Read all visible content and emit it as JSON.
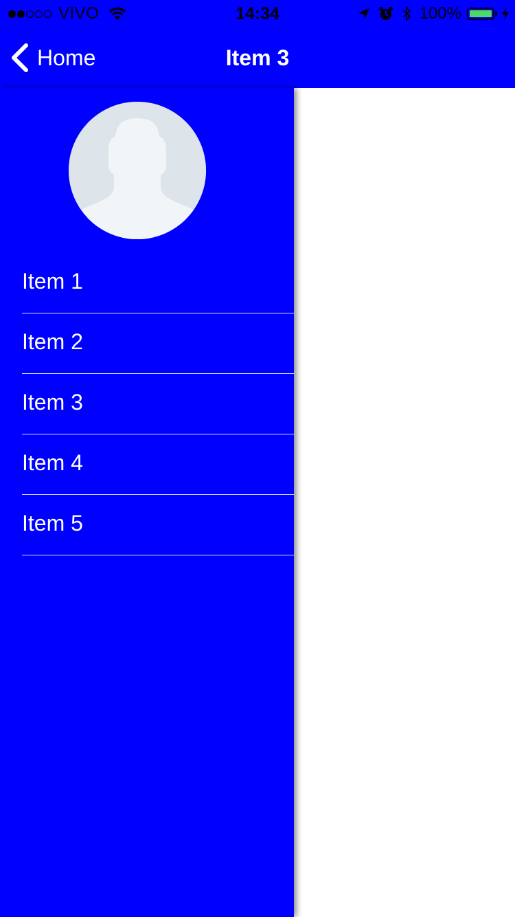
{
  "status_bar": {
    "carrier": "VIVO",
    "time": "14:34",
    "battery": "100%",
    "signal_bars_filled": 2,
    "signal_bars_total": 5,
    "battery_level": 1.0,
    "icons": [
      "wifi-icon",
      "location-arrow-icon",
      "alarm-icon",
      "bluetooth-icon",
      "charging-bolt-icon"
    ]
  },
  "nav": {
    "back_label": "Home",
    "title": "Item 3"
  },
  "drawer": {
    "avatar_icon": "default-user-avatar-icon",
    "items": [
      {
        "label": "Item 1"
      },
      {
        "label": "Item 2"
      },
      {
        "label": "Item 3"
      },
      {
        "label": "Item 4"
      },
      {
        "label": "Item 5"
      }
    ]
  },
  "colors": {
    "accent": "#0000ff",
    "text_on_accent": "#ffffff",
    "battery_fill": "#4cd964",
    "avatar_bg": "#dde4ea",
    "avatar_figure": "#f2f5f8"
  }
}
